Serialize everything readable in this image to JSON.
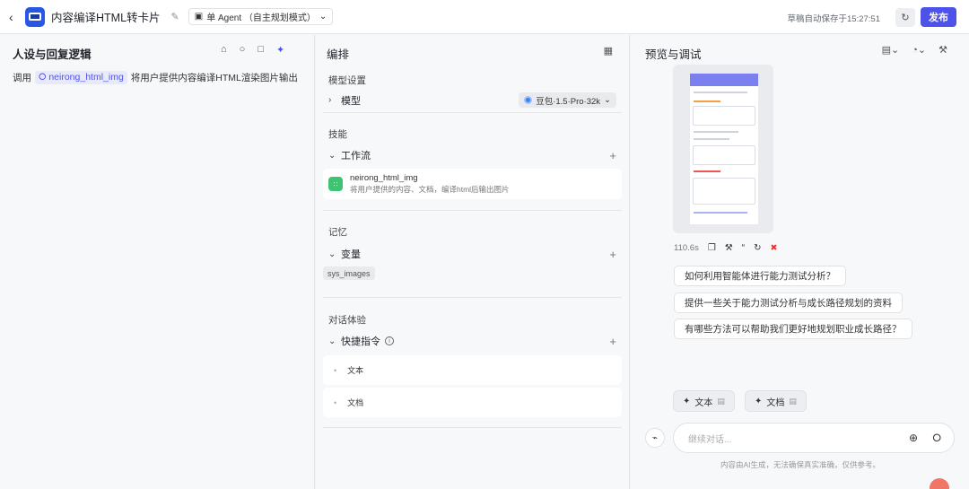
{
  "header": {
    "back_icon": "chevron-left-icon",
    "app_icon": "monitor-icon",
    "title": "内容编译HTML转卡片",
    "mode_label": "单 Agent （自主规划模式）",
    "saved_text": "草稿自动保存于15:27:51",
    "publish_label": "发布",
    "accent": "#4d53e8"
  },
  "left": {
    "title": "人设与回复逻辑",
    "prompt_prefix": "调用",
    "tool_name": "neirong_html_img",
    "prompt_suffix": "将用户提供内容编译HTML渲染图片输出"
  },
  "middle": {
    "title": "编排",
    "model_section": "模型设置",
    "model_row": "模型",
    "model_value": "豆包·1.5·Pro·32k",
    "skills_section": "技能",
    "workflow_row": "工作流",
    "workflow_name": "neirong_html_img",
    "workflow_desc": "将用户提供的内容、文档，编译html后输出图片",
    "memory_section": "记忆",
    "variable_row": "变量",
    "variable_chip": "sys_images",
    "dialog_section": "对话体验",
    "shortcut_row": "快捷指令",
    "shortcuts": [
      "文本",
      "文档"
    ]
  },
  "right": {
    "title": "预览与调试",
    "elapsed": "110.6s",
    "suggestions": [
      "如何利用智能体进行能力测试分析？",
      "提供一些关于能力测试分析与成长路径规划的资料",
      "有哪些方法可以帮助我们更好地规划职业成长路径？"
    ],
    "quick_buttons": [
      "文本",
      "文档"
    ],
    "input_placeholder": "继续对话...",
    "disclaimer": "内容由AI生成，无法确保真实准确，仅供参考。"
  }
}
